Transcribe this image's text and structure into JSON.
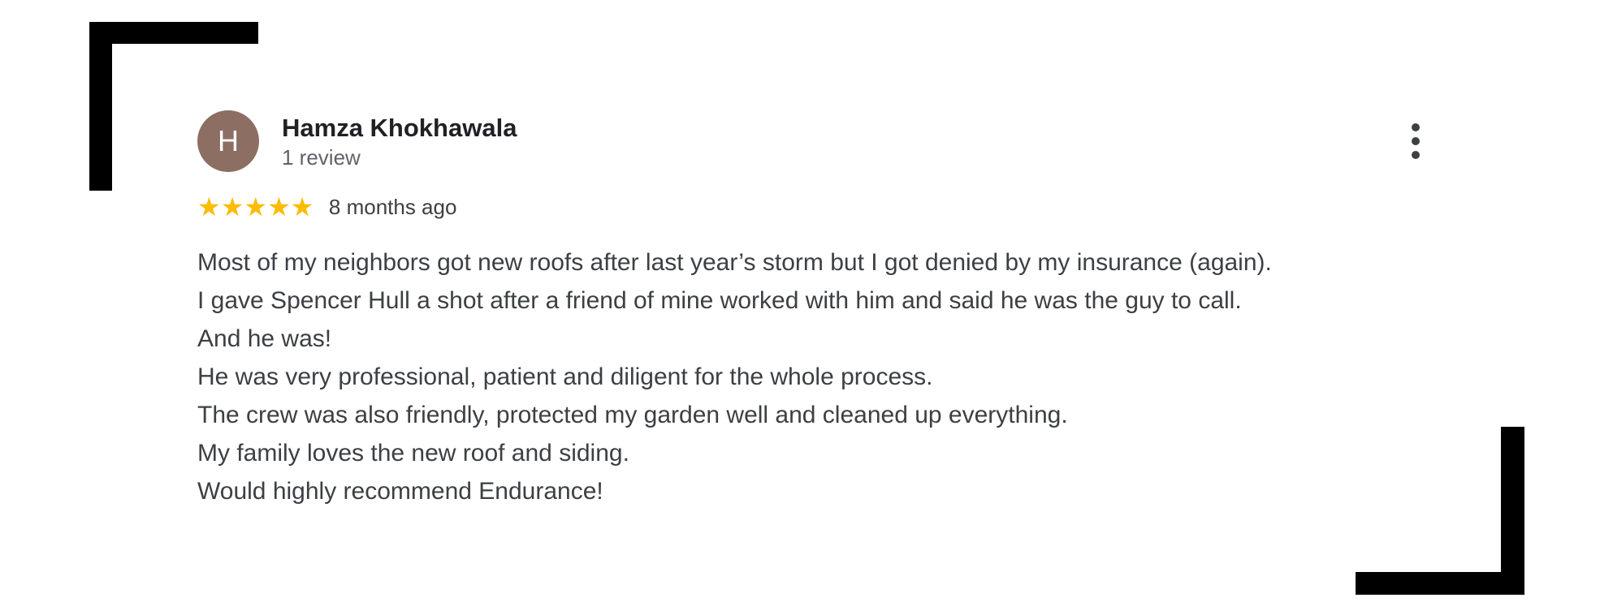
{
  "review": {
    "avatar_letter": "H",
    "author_name": "Hamza Khokhawala",
    "review_count": "1 review",
    "rating": 5,
    "rating_max": 5,
    "stars_display": "★★★★★",
    "time_ago": "8 months ago",
    "more_icon": "more-vert-icon",
    "body_lines": [
      "Most of my neighbors got new roofs after last year’s storm but I got denied by my insurance (again).",
      "I gave Spencer Hull a shot after a friend of mine worked with him and said he was the guy to call.",
      "And he was!",
      "He was very professional, patient and diligent for the whole process.",
      "The crew was also friendly, protected my garden well and cleaned up everything.",
      "My family loves the new roof and siding.",
      "Would highly recommend Endurance!"
    ]
  },
  "colors": {
    "avatar_bg": "#8d6e63",
    "star": "#fbbc04",
    "name_text": "#202124",
    "secondary_text": "#5f6368",
    "body_text": "#3c4043",
    "frame": "#000000"
  }
}
